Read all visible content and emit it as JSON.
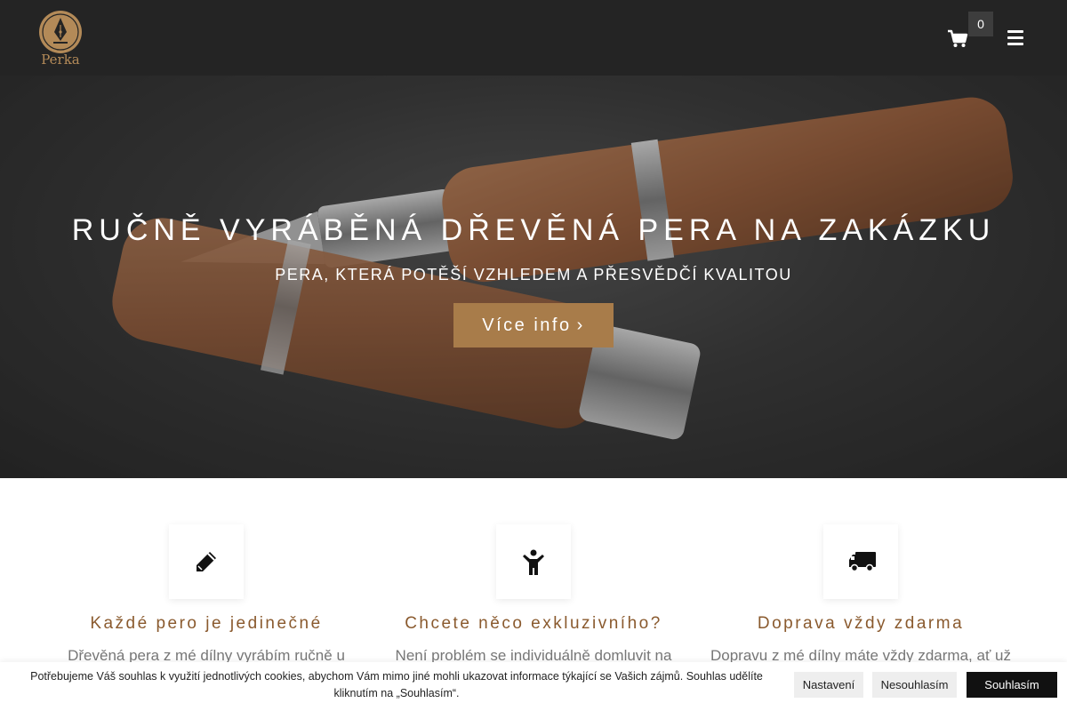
{
  "header": {
    "logo_text": "Perka",
    "cart_count": "0",
    "brand_color": "#b38a58"
  },
  "hero": {
    "title": "RUČNĚ VYRÁBĚNÁ DŘEVĚNÁ PERA NA ZAKÁZKU",
    "subtitle": "PERA, KTERÁ POTĚŠÍ VZHLEDEM A PŘESVĚDČÍ KVALITOU",
    "button_label": "Více info",
    "button_icon": "chevron-right-icon",
    "accent_color": "#a87c4a"
  },
  "features": [
    {
      "icon": "pencil-icon",
      "title": "Každé pero je jedinečné",
      "text": "Dřevěná pera z mé dílny vyrábím ručně u"
    },
    {
      "icon": "child-icon",
      "title": "Chcete něco exkluzivního?",
      "text": "Není problém se individuálně domluvit na"
    },
    {
      "icon": "truck-icon",
      "title": "Doprava vždy zdarma",
      "text": "Dopravu z mé dílny máte vždy zdarma, ať už"
    }
  ],
  "cookie_bar": {
    "text": "Potřebujeme Váš souhlas k využití jednotlivých cookies, abychom Vám mimo jiné mohli ukazovat informace týkající se Vašich zájmů. Souhlas udělíte kliknutím na „Souhlasím“.",
    "settings_label": "Nastavení",
    "decline_label": "Nesouhlasím",
    "accept_label": "Souhlasím"
  }
}
